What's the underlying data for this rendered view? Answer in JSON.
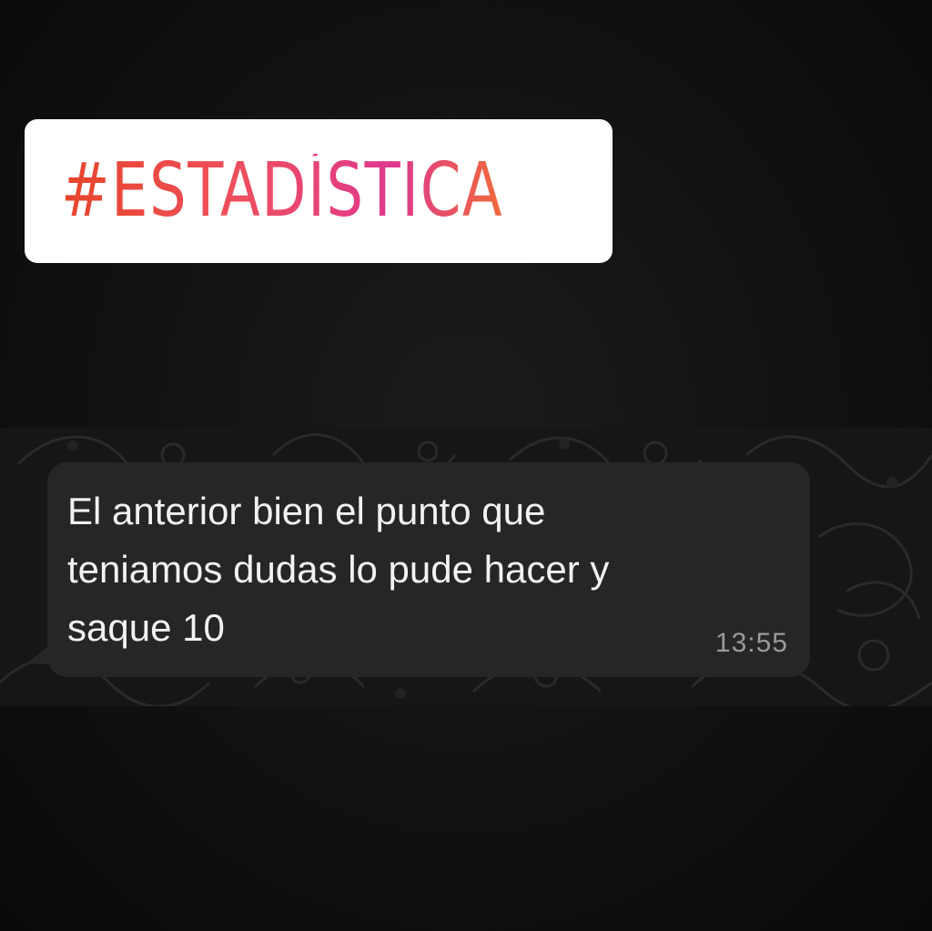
{
  "sticker": {
    "hashtag": "#ESTADÍSTICA"
  },
  "message": {
    "text": "El anterior bien el punto que\nteniamos dudas lo pude hacer y\nsaque 10",
    "time": "13:55"
  },
  "colors": {
    "background": "#0b0b0b",
    "bubble": "#262626",
    "sticker_bg": "#ffffff",
    "hashtag_gradient_start": "#e8452a",
    "hashtag_gradient_end": "#e0388f"
  }
}
